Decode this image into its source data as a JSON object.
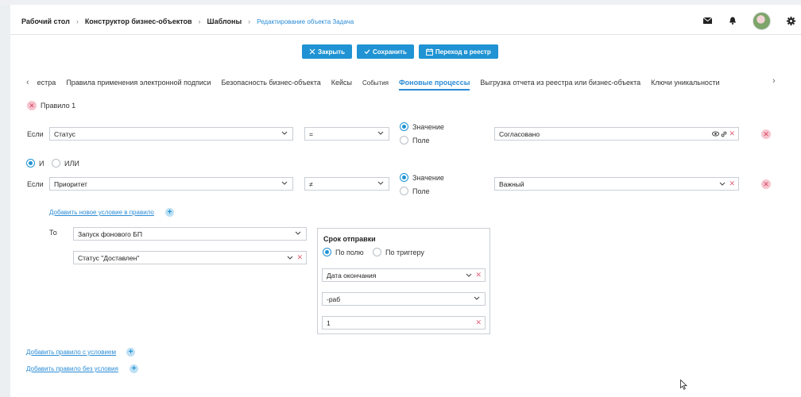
{
  "breadcrumb": [
    "Рабочий стол",
    "Конструктор бизнес-объектов",
    "Шаблоны",
    "Редактирование объекта Задача"
  ],
  "toolbar": {
    "close_label": "Закрыть",
    "save_label": "Сохранить",
    "registry_label": "Переход в реестр"
  },
  "tabs": [
    {
      "label": "естра"
    },
    {
      "label": "Правила применения электронной подписи"
    },
    {
      "label": "Безопасность бизнес-объекта"
    },
    {
      "label": "Кейсы"
    },
    {
      "label": "События"
    },
    {
      "label": "Фоновые процессы",
      "active": true
    },
    {
      "label": "Выгрузка отчета из реестра или бизнес-объекта"
    },
    {
      "label": "Ключи уникальности"
    }
  ],
  "rule": {
    "title": "Правило 1",
    "conditions": [
      {
        "if_label": "Если",
        "field": "Статус",
        "operator": "=",
        "value_type_options": [
          "Значение",
          "Поле"
        ],
        "value_type_selected": "Значение",
        "value": "Согласовано"
      },
      {
        "if_label": "Если",
        "field": "Приоритет",
        "operator": "≠",
        "value_type_options": [
          "Значение",
          "Поле"
        ],
        "value_type_selected": "Значение",
        "value": "Важный"
      }
    ],
    "logic_options": [
      "И",
      "ИЛИ"
    ],
    "logic_selected": "И",
    "add_condition_link": "Добавить новое условие в правило",
    "then_label": "То",
    "action": "Запуск фонового БП",
    "action_param": "Статус \"Доставлен\""
  },
  "deadline": {
    "title": "Срок отправки",
    "mode_options": [
      "По полю",
      "По триггеру"
    ],
    "mode_selected": "По полю",
    "date_field": "Дата окончания",
    "unit": "-раб",
    "amount": "1"
  },
  "links": {
    "add_rule_with_condition": "Добавить правило с условием",
    "add_rule_without_condition": "Добавить правило без условия"
  },
  "colors": {
    "accent": "#1f93d3",
    "link": "#2b8cd6",
    "danger": "#e0607a"
  }
}
